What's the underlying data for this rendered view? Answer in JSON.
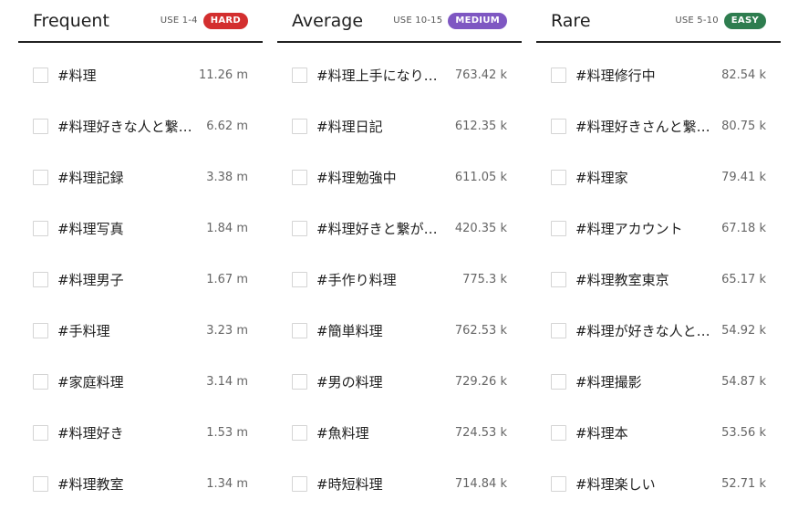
{
  "colors": {
    "hard": "#d32f2f",
    "medium": "#7e57c2",
    "easy": "#2e7d4f"
  },
  "columns": [
    {
      "title": "Frequent",
      "use": "USE 1-4",
      "badge": "HARD",
      "badge_color": "#d32f2f",
      "items": [
        {
          "tag": "#料理",
          "count": "11.26 m"
        },
        {
          "tag": "#料理好きな人と繋がりたい",
          "count": "6.62 m"
        },
        {
          "tag": "#料理記録",
          "count": "3.38 m"
        },
        {
          "tag": "#料理写真",
          "count": "1.84 m"
        },
        {
          "tag": "#料理男子",
          "count": "1.67 m"
        },
        {
          "tag": "#手料理",
          "count": "3.23 m"
        },
        {
          "tag": "#家庭料理",
          "count": "3.14 m"
        },
        {
          "tag": "#料理好き",
          "count": "1.53 m"
        },
        {
          "tag": "#料理教室",
          "count": "1.34 m"
        }
      ]
    },
    {
      "title": "Average",
      "use": "USE 10-15",
      "badge": "MEDIUM",
      "badge_color": "#7e57c2",
      "items": [
        {
          "tag": "#料理上手になりたい",
          "count": "763.42 k"
        },
        {
          "tag": "#料理日記",
          "count": "612.35 k"
        },
        {
          "tag": "#料理勉強中",
          "count": "611.05 k"
        },
        {
          "tag": "#料理好きと繋がりたい",
          "count": "420.35 k"
        },
        {
          "tag": "#手作り料理",
          "count": "775.3 k"
        },
        {
          "tag": "#簡単料理",
          "count": "762.53 k"
        },
        {
          "tag": "#男の料理",
          "count": "729.26 k"
        },
        {
          "tag": "#魚料理",
          "count": "724.53 k"
        },
        {
          "tag": "#時短料理",
          "count": "714.84 k"
        }
      ]
    },
    {
      "title": "Rare",
      "use": "USE 5-10",
      "badge": "EASY",
      "badge_color": "#2e7d4f",
      "items": [
        {
          "tag": "#料理修行中",
          "count": "82.54 k"
        },
        {
          "tag": "#料理好きさんと繋がりたい",
          "count": "80.75 k"
        },
        {
          "tag": "#料理家",
          "count": "79.41 k"
        },
        {
          "tag": "#料理アカウント",
          "count": "67.18 k"
        },
        {
          "tag": "#料理教室東京",
          "count": "65.17 k"
        },
        {
          "tag": "#料理が好きな人と繋がりたい",
          "count": "54.92 k"
        },
        {
          "tag": "#料理撮影",
          "count": "54.87 k"
        },
        {
          "tag": "#料理本",
          "count": "53.56 k"
        },
        {
          "tag": "#料理楽しい",
          "count": "52.71 k"
        }
      ]
    }
  ]
}
